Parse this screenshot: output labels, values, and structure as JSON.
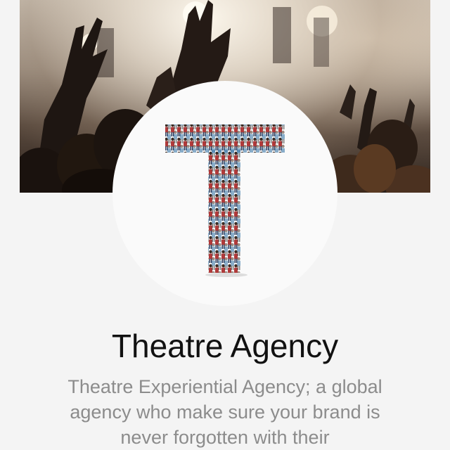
{
  "profile": {
    "name": "Theatre Agency",
    "description": "Theatre Experiential Agency; a global agency who make sure your brand is never forgotten with their",
    "avatar_icon": "letter-t-crowd-logo",
    "cover_image": "concert-crowd-photo"
  },
  "colors": {
    "background": "#f4f4f4",
    "title": "#111111",
    "description": "#8c8c8c",
    "avatar_bg": "#fafafa"
  }
}
